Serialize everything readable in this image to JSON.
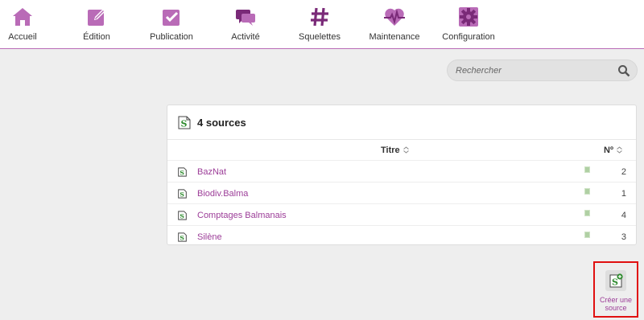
{
  "nav": {
    "items": [
      {
        "label": "Accueil",
        "icon": "home-icon"
      },
      {
        "label": "Édition",
        "icon": "edit-icon"
      },
      {
        "label": "Publication",
        "icon": "check-icon"
      },
      {
        "label": "Activité",
        "icon": "chat-icon"
      },
      {
        "label": "Squelettes",
        "icon": "hash-icon"
      },
      {
        "label": "Maintenance",
        "icon": "pulse-icon"
      },
      {
        "label": "Configuration",
        "icon": "gear-icon"
      }
    ]
  },
  "search": {
    "placeholder": "Rechercher",
    "value": ""
  },
  "sources": {
    "title": "4 sources",
    "columns": {
      "title": "Titre",
      "number": "Nº"
    },
    "rows": [
      {
        "title": "BazNat",
        "number": "2"
      },
      {
        "title": "Biodiv.Balma",
        "number": "1"
      },
      {
        "title": "Comptages Balmanais",
        "number": "4"
      },
      {
        "title": "Silène",
        "number": "3"
      }
    ]
  },
  "create": {
    "label_line1": "Créer une",
    "label_line2": "source"
  },
  "colors": {
    "accent": "#9c3d98",
    "nav_icon": "#b96bb7",
    "border_highlight": "#e01010",
    "doc_green": "#2e8b2e"
  }
}
